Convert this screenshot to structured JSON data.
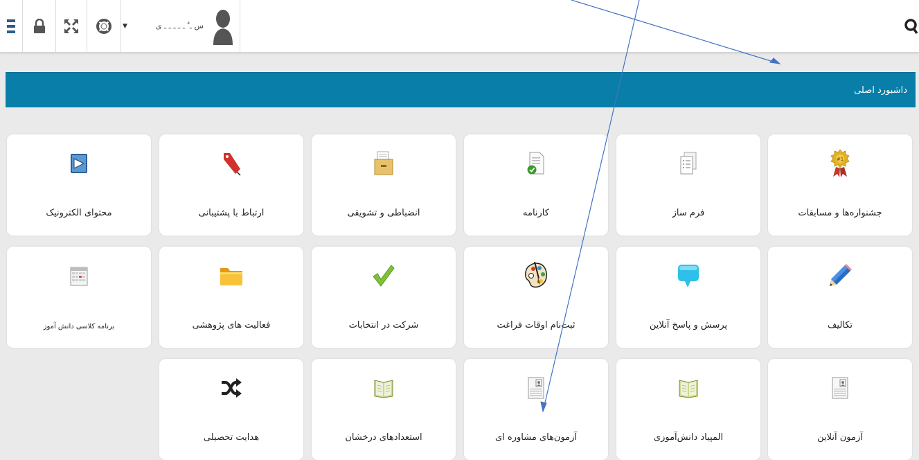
{
  "header": {
    "username": "س ـ ٌ ـ ـ ـ ـ ـ ی",
    "icons": [
      "menu-icon",
      "lock-icon",
      "expand-icon",
      "lifebuoy-icon",
      "avatar-icon",
      "search-icon"
    ]
  },
  "banner": {
    "title": "داشبورد اصلی",
    "color": "#087ea9"
  },
  "tiles": [
    {
      "label": "جشنواره‌ها و مسابقات",
      "icon": "award-badge-icon"
    },
    {
      "label": "فرم ساز",
      "icon": "form-documents-icon"
    },
    {
      "label": "کارنامه",
      "icon": "report-card-icon"
    },
    {
      "label": "انضباطی و تشویقی",
      "icon": "archive-box-icon"
    },
    {
      "label": "ارتباط با پشتیبانی",
      "icon": "red-tag-icon"
    },
    {
      "label": "محتوای الکترونیک",
      "icon": "electronic-content-icon"
    },
    {
      "label": "تکالیف",
      "icon": "pencil-icon"
    },
    {
      "label": "پرسش و پاسخ آنلاین",
      "icon": "speech-bubble-icon"
    },
    {
      "label": "ثبت‌نام اوقات فراغت",
      "icon": "palette-icon"
    },
    {
      "label": "شرکت در انتخابات",
      "icon": "checkmark-icon"
    },
    {
      "label": "فعالیت های پژوهشی",
      "icon": "folder-icon"
    },
    {
      "label": "برنامه کلاسی دانش آموز",
      "icon": "calendar-icon"
    },
    {
      "label": "آزمون آنلاین",
      "icon": "exam-sheet-icon"
    },
    {
      "label": "المپیاد دانش‌آموزی",
      "icon": "open-book-icon"
    },
    {
      "label": "آزمون‌های مشاوره ای",
      "icon": "exam-sheet-icon"
    },
    {
      "label": "استعدادهای درخشان",
      "icon": "open-book-icon"
    },
    {
      "label": "هدایت تحصیلی",
      "icon": "shuffle-icon"
    }
  ]
}
